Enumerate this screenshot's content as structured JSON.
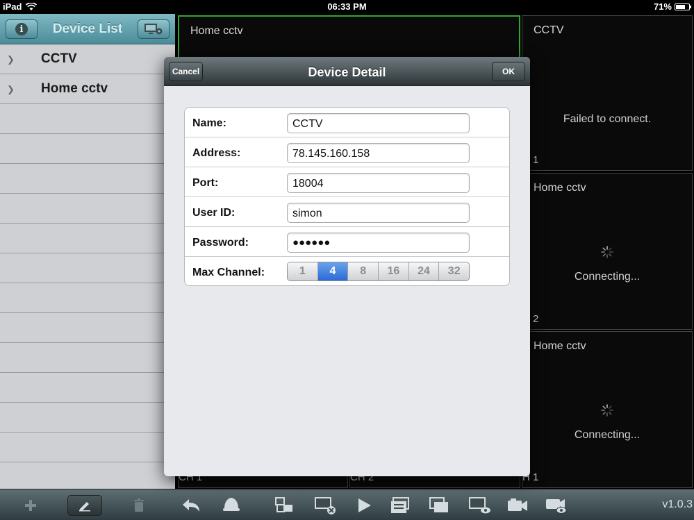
{
  "status_bar": {
    "device": "iPad",
    "time": "06:33 PM",
    "battery": "71%",
    "battery_level": 0.71
  },
  "sidebar": {
    "title": "Device List",
    "items": [
      {
        "label": "CCTV"
      },
      {
        "label": "Home cctv"
      }
    ]
  },
  "grid": {
    "cells": [
      {
        "name": "Home cctv",
        "message": "",
        "channel": ""
      },
      {
        "name": "CCTV",
        "message": "Failed to connect.",
        "channel": "H 1"
      },
      {
        "name": "Home cctv",
        "message": "Connecting...",
        "channel": "H 2"
      },
      {
        "name": "Home cctv",
        "message": "Connecting...",
        "channel": "H 1"
      },
      {
        "name": "",
        "message": "",
        "channel": "CH 1"
      },
      {
        "name": "",
        "message": "",
        "channel": "CH 2"
      }
    ]
  },
  "dialog": {
    "title": "Device Detail",
    "cancel_label": "Cancel",
    "ok_label": "OK",
    "fields": {
      "name": {
        "label": "Name:",
        "value": "CCTV"
      },
      "address": {
        "label": "Address:",
        "value": "78.145.160.158"
      },
      "port": {
        "label": "Port:",
        "value": "18004"
      },
      "user_id": {
        "label": "User ID:",
        "value": "simon"
      },
      "password": {
        "label": "Password:",
        "value": "●●●●●●"
      },
      "max_channel": {
        "label": "Max Channel:",
        "options": [
          "1",
          "4",
          "8",
          "16",
          "24",
          "32"
        ],
        "selected": "4"
      }
    }
  },
  "toolbar": {
    "version": "v1.0.3"
  },
  "colors": {
    "accent_green": "#2ea82e",
    "selected_blue": "#2a6ad6",
    "sidebar_header": "#4b8b98"
  }
}
